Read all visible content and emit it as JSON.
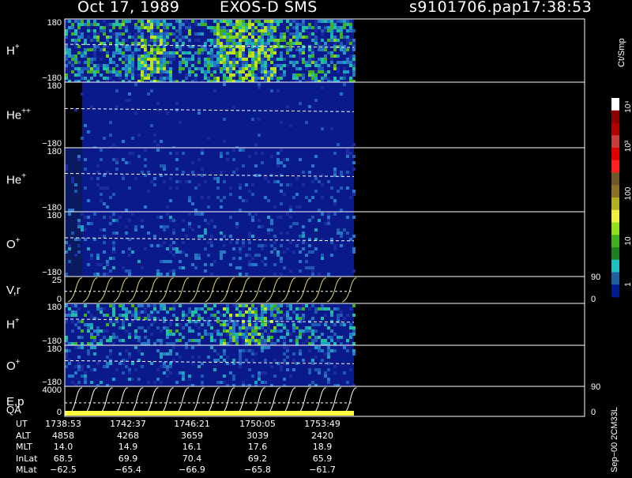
{
  "header": {
    "date": "Oct 17, 1989",
    "instrument": "EXOS-D SMS",
    "file": "s9101706.pap",
    "time": "17:38:53"
  },
  "colors": {
    "background": "#000000",
    "bg_blue": "#0a1a8a",
    "dashed_line": "#ffffff",
    "curve": "#e8d87a",
    "qa_bar": "#ffff40"
  },
  "panels": [
    {
      "label": "H",
      "sup": "+",
      "tick_top": "180",
      "tick_bot": "−180"
    },
    {
      "label": "He",
      "sup": "++",
      "tick_top": "180",
      "tick_bot": "−180"
    },
    {
      "label": "He",
      "sup": "+",
      "tick_top": "180",
      "tick_bot": "−180"
    },
    {
      "label": "O",
      "sup": "+",
      "tick_top": "180",
      "tick_bot": "−180"
    },
    {
      "label": "V,r",
      "sup": "",
      "tick_top": "25",
      "tick_bot": "0",
      "right_top": "90",
      "right_bot": "0"
    },
    {
      "label": "H",
      "sup": "+",
      "tick_top": "180",
      "tick_bot": "−180"
    },
    {
      "label": "O",
      "sup": "+",
      "tick_top": "180",
      "tick_bot": "−180"
    },
    {
      "label": "E,p",
      "sup": "",
      "tick_top": "4000",
      "tick_bot": "0",
      "right_top": "90",
      "right_bot": "0"
    }
  ],
  "qa_label": "QA",
  "colorbar": {
    "unit": "Ct/Smp",
    "tick_labels": [
      "10⁴",
      "10³",
      "100",
      "10",
      "1"
    ],
    "colors": [
      "#ffffff",
      "#8b0000",
      "#b00000",
      "#c83c3c",
      "#e00000",
      "#ff2020",
      "#6e5a28",
      "#8c7228",
      "#b0b020",
      "#f0f040",
      "#90e020",
      "#40b020",
      "#208020",
      "#20c0c0",
      "#2060a0",
      "#001a8a"
    ]
  },
  "footer_rows": [
    {
      "label": "UT",
      "values": [
        "1738:53",
        "1742:37",
        "1746:21",
        "1750:05",
        "1753:49"
      ]
    },
    {
      "label": "ALT",
      "values": [
        "4858",
        "4268",
        "3659",
        "3039",
        "2420"
      ]
    },
    {
      "label": "MLT",
      "values": [
        "14.0",
        "14.9",
        "16.1",
        "17.6",
        "18.9"
      ]
    },
    {
      "label": "InLat",
      "values": [
        "68.5",
        "69.9",
        "70.4",
        "69.2",
        "65.9"
      ]
    },
    {
      "label": "MLat",
      "values": [
        "−62.5",
        "−65.4",
        "−66.9",
        "−65.8",
        "−61.7"
      ]
    }
  ],
  "side_note": "Sep−00 2CM33L",
  "chart_data": {
    "type": "heatmap",
    "title": "Oct 17, 1989   EXOS-D SMS",
    "panels": [
      "H+",
      "He++",
      "He+",
      "O+",
      "V,r",
      "H+",
      "O+",
      "E,p"
    ],
    "y_ranges": [
      [
        -180,
        180
      ],
      [
        -180,
        180
      ],
      [
        -180,
        180
      ],
      [
        -180,
        180
      ],
      [
        0,
        25
      ],
      [
        -180,
        180
      ],
      [
        -180,
        180
      ],
      [
        0,
        4000
      ]
    ],
    "colorbar_unit": "Ct/Smp",
    "colorbar_ticks": [
      "1",
      "10",
      "100",
      "10³",
      "10⁴"
    ],
    "x_ticks_ut": [
      "1738:53",
      "1742:37",
      "1746:21",
      "1750:05",
      "1753:49"
    ]
  }
}
